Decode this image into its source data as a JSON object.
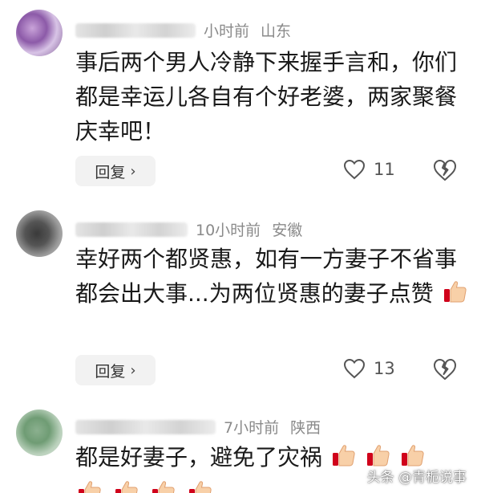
{
  "comments": [
    {
      "time": "小时前",
      "location": "山东",
      "text": "事后两个男人冷静下来握手言和，你们都是幸运儿各自有个好老婆，两家聚餐庆幸吧！",
      "reply_label": "回复",
      "likes": "11"
    },
    {
      "time": "10小时前",
      "location": "安徽",
      "text": "幸好两个都贤惠，如有一方妻子不省事都会出大事...为两位贤惠的妻子点赞",
      "reply_label": "回复",
      "likes": "13"
    },
    {
      "time": "7小时前",
      "location": "陕西",
      "text": "都是好妻子，避免了灾祸"
    }
  ],
  "watermark": "头条 @青栀说事",
  "icons": {
    "like": "heart-outline-icon",
    "dislike": "broken-heart-icon",
    "reply_arrow": "chevron-right-icon",
    "emoji": "thumbs-up-emoji"
  },
  "colors": {
    "meta_text": "#8a8a8a",
    "reply_bg": "#f2f2f2",
    "emoji": "#f5a623"
  }
}
